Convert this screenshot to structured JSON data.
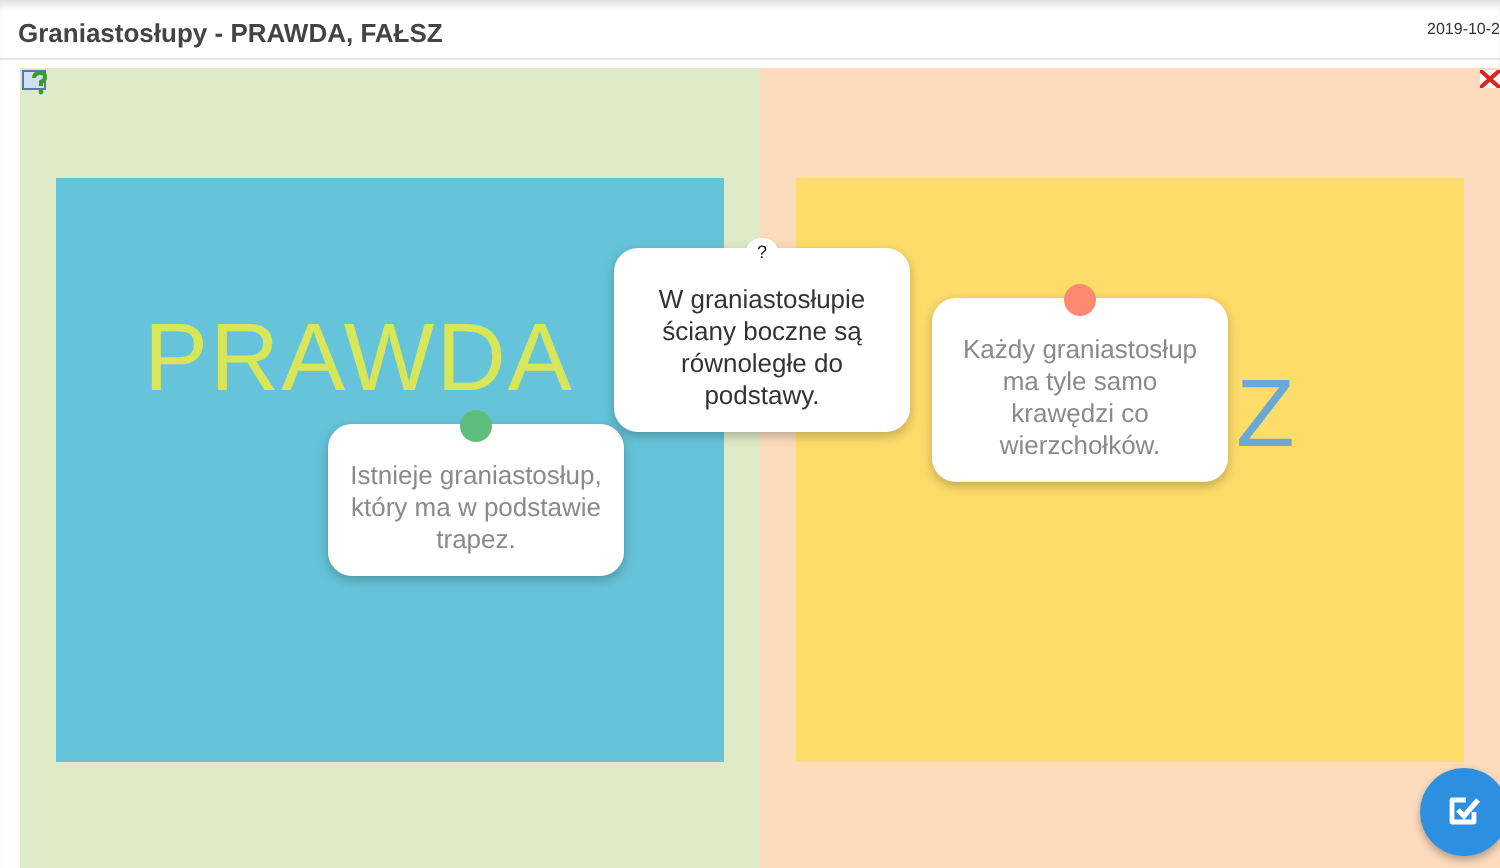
{
  "header": {
    "title": "Graniastosłupy - PRAWDA, FAŁSZ",
    "date": "2019-10-2"
  },
  "categories": [
    {
      "label": "PRAWDA"
    },
    {
      "label": "Z"
    }
  ],
  "cards": [
    {
      "text": "Istnieje graniastosłup, który ma w podstawie trapez.",
      "active": false,
      "color": "#5dbe7c"
    },
    {
      "text": "W graniastosłupie ściany boczne są równoległe do podstawy.",
      "active": true,
      "marker": "?"
    },
    {
      "text": "Każdy graniastosłup ma tyle samo krawędzi co wierzchołków.",
      "active": false,
      "color": "#fa8a6f"
    }
  ]
}
